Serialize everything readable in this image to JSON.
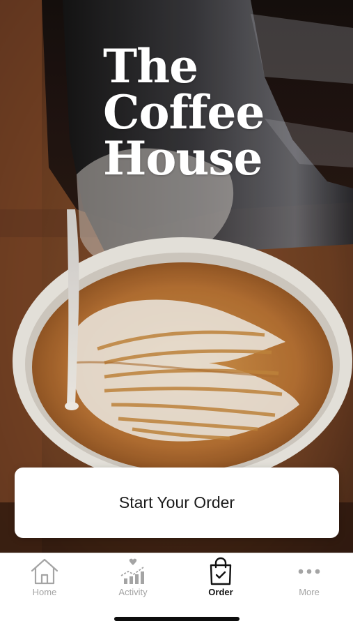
{
  "brand": {
    "title_lines": [
      "The",
      "Coffee",
      "House"
    ]
  },
  "hero": {
    "image": "latte-art-pour-photo",
    "colors": {
      "table": "#6b3d22",
      "crema": "#c98a3e",
      "cup_rim": "#f1ede6",
      "milk": "#f4efe7"
    }
  },
  "cta": {
    "label": "Start Your Order"
  },
  "tabbar": {
    "tabs": [
      {
        "label": "Home",
        "icon": "house-icon",
        "active": false
      },
      {
        "label": "Activity",
        "icon": "activity-chart-icon",
        "active": false
      },
      {
        "label": "Order",
        "icon": "shopping-bag-check-icon",
        "active": true
      },
      {
        "label": "More",
        "icon": "more-dots-icon",
        "active": false
      }
    ],
    "active_color": "#111111",
    "inactive_color": "#a4a4a4"
  }
}
